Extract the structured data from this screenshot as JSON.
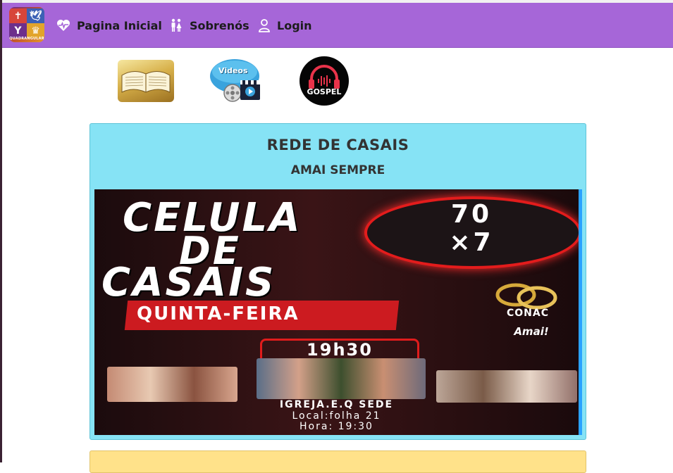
{
  "colors": {
    "navbar": "#a666d8",
    "card_blue": "#86e3f5",
    "card_yellow": "#ffe28a",
    "poster_red": "#cc1b20"
  },
  "brand": {
    "logo_icon": "quadrangular-logo",
    "logo_caption": "QUADRANGULAR"
  },
  "nav": {
    "items": [
      {
        "label": "Pagina Inicial",
        "icon": "heart-pulse-icon"
      },
      {
        "label": "Sobrenós",
        "icon": "people-icon"
      },
      {
        "label": "Login",
        "icon": "user-icon"
      }
    ]
  },
  "shortcuts": [
    {
      "name": "bible",
      "icon": "open-bible-image"
    },
    {
      "name": "videos",
      "label": "Videos",
      "icon": "video-reel-image"
    },
    {
      "name": "gospel",
      "label": "GOSPEL",
      "icon": "headphones-image"
    }
  ],
  "cards": [
    {
      "title": "REDE DE CASAIS",
      "subtitle": "AMAI SEMPRE",
      "poster": {
        "line1": "CELULA",
        "line2": "DE",
        "line3": "CASAIS",
        "day": "QUINTA-FEIRA",
        "badge": "70 ×7",
        "logo_text": "CONAC",
        "logo_tag": "Amai!",
        "time": "19h30",
        "venue": "IGREJA.E.Q SEDE",
        "local": "Local:folha 21",
        "hora": "Hora: 19:30"
      }
    }
  ]
}
